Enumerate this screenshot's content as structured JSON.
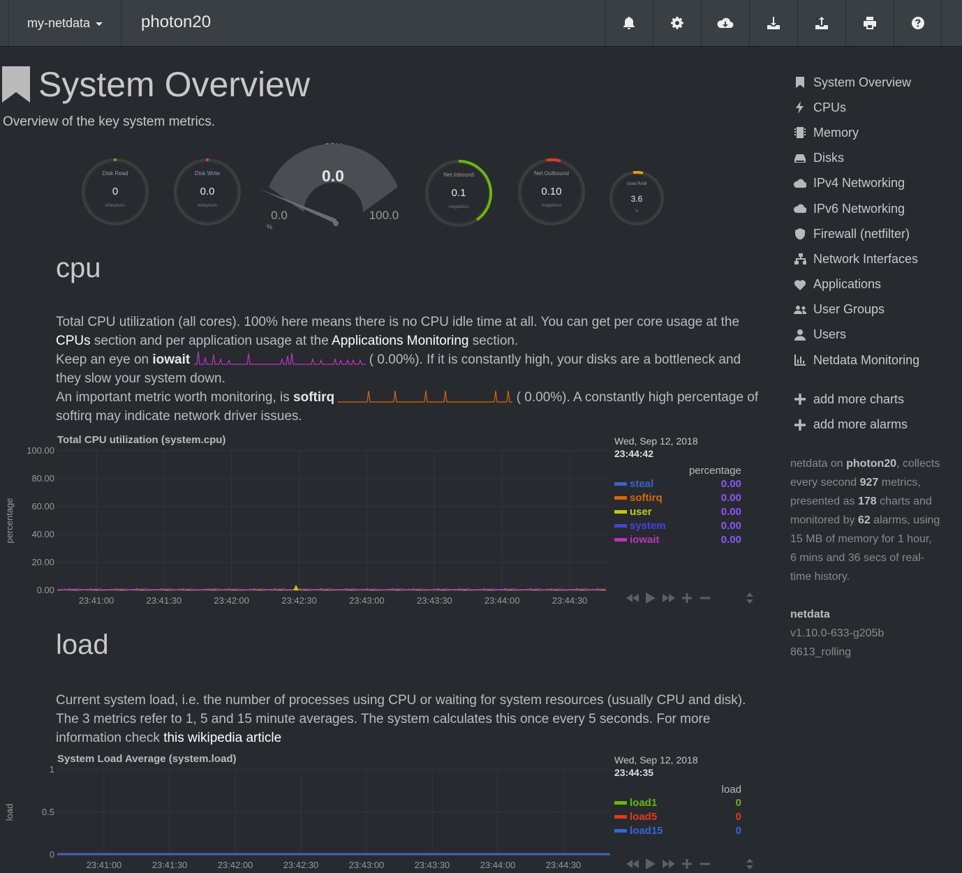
{
  "navbar": {
    "brand": "my-netdata",
    "hostname": "photon20",
    "icons": [
      "bell-icon",
      "gear-icon",
      "cloud-download-icon",
      "download-icon",
      "upload-icon",
      "print-icon",
      "help-icon"
    ]
  },
  "header": {
    "title": "System Overview",
    "subtitle": "Overview of the key system metrics."
  },
  "gauges": {
    "disk_read": {
      "label": "Disk Read",
      "value": "0",
      "units": "kilobytes/s"
    },
    "disk_write": {
      "label": "Disk Write",
      "value": "0.0",
      "units": "kilobytes/s"
    },
    "cpu": {
      "label": "CPU",
      "value": "0.0",
      "min": "0.0",
      "max": "100.0",
      "units": "%"
    },
    "net_inbound": {
      "label": "Net Inbound",
      "value": "0.1",
      "units": "megabits/s"
    },
    "net_outbound": {
      "label": "Net Outbound",
      "value": "0.10",
      "units": "megabits/s"
    },
    "used_ram": {
      "label": "Used RAM",
      "value": "3.6",
      "units": "%"
    }
  },
  "cpu_section": {
    "title": "cpu",
    "p1a": "Total CPU utilization (all cores). 100% here means there is no CPU idle time at all. You can get per core usage at the ",
    "p1_link1": "CPUs",
    "p1b": " section and per application usage at the ",
    "p1_link2": "Applications Monitoring",
    "p1c": " section.",
    "p2a": "Keep an eye on ",
    "p2_bold": "iowait",
    "p2_val": "(      0.00%)",
    "p2b": ". If it is constantly high, your disks are a bottleneck and they slow your system down.",
    "p3a": "An important metric worth monitoring, is ",
    "p3_bold": "softirq",
    "p3_val": "(      0.00%)",
    "p3b": ". A constantly high percentage of softirq may indicate network driver issues.",
    "chart": {
      "title": "Total CPU utilization (system.cpu)",
      "date": "Wed, Sep 12, 2018",
      "time": "23:44:42",
      "units": "percentage",
      "ylabel": "percentage",
      "yticks": [
        "100.00",
        "80.00",
        "60.00",
        "40.00",
        "20.00",
        "0.00"
      ],
      "xticks": [
        "23:41:00",
        "23:41:30",
        "23:42:00",
        "23:42:30",
        "23:43:00",
        "23:43:30",
        "23:44:00",
        "23:44:30"
      ],
      "legend": [
        {
          "name": "steal",
          "value": "0.00",
          "color": "#3366cc"
        },
        {
          "name": "softirq",
          "value": "0.00",
          "color": "#dd6600"
        },
        {
          "name": "user",
          "value": "0.00",
          "color": "#c8c800"
        },
        {
          "name": "system",
          "value": "0.00",
          "color": "#4444dd"
        },
        {
          "name": "iowait",
          "value": "0.00",
          "color": "#bb33bb"
        }
      ],
      "value_color": "#8855ff"
    }
  },
  "load_section": {
    "title": "load",
    "pa": "Current system load, i.e. the number of processes using CPU or waiting for system resources (usually CPU and disk). The 3 metrics refer to 1, 5 and 15 minute averages. The system calculates this once every 5 seconds. For more information check ",
    "link": "this wikipedia article",
    "chart": {
      "title": "System Load Average (system.load)",
      "date": "Wed, Sep 12, 2018",
      "time": "23:44:35",
      "units": "load",
      "ylabel": "load",
      "yticks": [
        "1",
        "0.5",
        "0"
      ],
      "xticks": [
        "23:41:00",
        "23:41:30",
        "23:42:00",
        "23:42:30",
        "23:43:00",
        "23:43:30",
        "23:44:00",
        "23:44:30"
      ],
      "legend": [
        {
          "name": "load1",
          "value": "0",
          "color": "#66bb00"
        },
        {
          "name": "load5",
          "value": "0",
          "color": "#ee3322"
        },
        {
          "name": "load15",
          "value": "0",
          "color": "#3366dd"
        }
      ]
    }
  },
  "sidebar": {
    "items": [
      {
        "label": "System Overview",
        "icon": "bookmark-icon"
      },
      {
        "label": "CPUs",
        "icon": "bolt-icon"
      },
      {
        "label": "Memory",
        "icon": "memory-icon"
      },
      {
        "label": "Disks",
        "icon": "hdd-icon"
      },
      {
        "label": "IPv4 Networking",
        "icon": "cloud-icon"
      },
      {
        "label": "IPv6 Networking",
        "icon": "cloud-icon"
      },
      {
        "label": "Firewall (netfilter)",
        "icon": "shield-icon"
      },
      {
        "label": "Network Interfaces",
        "icon": "sitemap-icon"
      },
      {
        "label": "Applications",
        "icon": "heartbeat-icon"
      },
      {
        "label": "User Groups",
        "icon": "users-icon"
      },
      {
        "label": "Users",
        "icon": "user-icon"
      },
      {
        "label": "Netdata Monitoring",
        "icon": "bar-chart-icon"
      }
    ],
    "add_charts": "add more charts",
    "add_alarms": "add more alarms"
  },
  "info": {
    "t1": "netdata on ",
    "host": "photon20",
    "t2": ", collects every second ",
    "metrics": "927",
    "t3": " metrics, presented as ",
    "charts": "178",
    "t4": " charts and monitored by ",
    "alarms": "62",
    "t5": " alarms, using 15 MB of memory for 1 hour, 6 mins and 36 secs of real-time history.",
    "version_title": "netdata",
    "version": "v1.10.0-633-g205b8613_rolling"
  }
}
